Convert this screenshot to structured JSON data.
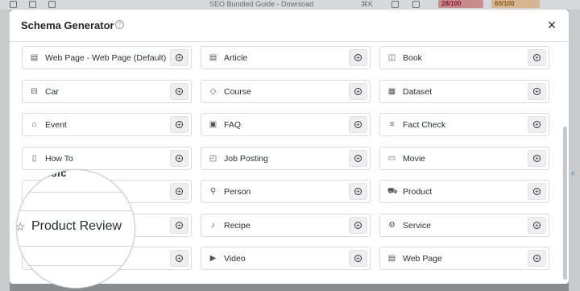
{
  "background": {
    "tab_title": "SEO Bundled Guide - Download",
    "shortcut": "⌘K",
    "score_red": "28/100",
    "score_orange": "60/100"
  },
  "modal": {
    "title": "Schema Generator",
    "help_icon": "question-circle-icon",
    "close_icon": "×"
  },
  "items": [
    {
      "label": "Web Page - Web Page (Default)",
      "icon": "page-icon",
      "glyph": "▤"
    },
    {
      "label": "Article",
      "icon": "article-icon",
      "glyph": "▤"
    },
    {
      "label": "Book",
      "icon": "book-icon",
      "glyph": "◫"
    },
    {
      "label": "Car",
      "icon": "car-icon",
      "glyph": "⊟"
    },
    {
      "label": "Course",
      "icon": "graduation-cap-icon",
      "glyph": "◇"
    },
    {
      "label": "Dataset",
      "icon": "dataset-icon",
      "glyph": "▦"
    },
    {
      "label": "Event",
      "icon": "event-icon",
      "glyph": "⌂"
    },
    {
      "label": "FAQ",
      "icon": "faq-icon",
      "glyph": "▣"
    },
    {
      "label": "Fact Check",
      "icon": "fact-check-icon",
      "glyph": "≡"
    },
    {
      "label": "How To",
      "icon": "how-to-icon",
      "glyph": "▯"
    },
    {
      "label": "Job Posting",
      "icon": "briefcase-icon",
      "glyph": "◰"
    },
    {
      "label": "Movie",
      "icon": "movie-icon",
      "glyph": "▭"
    },
    {
      "label": "",
      "icon": "music-icon",
      "glyph": ""
    },
    {
      "label": "Person",
      "icon": "person-icon",
      "glyph": "⚲"
    },
    {
      "label": "Product",
      "icon": "cart-icon",
      "glyph": "⛟"
    },
    {
      "label": "",
      "icon": "review-icon",
      "glyph": ""
    },
    {
      "label": "Recipe",
      "icon": "recipe-icon",
      "glyph": "♪"
    },
    {
      "label": "Service",
      "icon": "service-icon",
      "glyph": "⚙"
    },
    {
      "label": "",
      "icon": "software-icon",
      "glyph": ""
    },
    {
      "label": "Video",
      "icon": "video-icon",
      "glyph": "▶"
    },
    {
      "label": "Web Page",
      "icon": "web-page-icon",
      "glyph": "▤"
    }
  ],
  "add_glyph": "+",
  "magnifier": {
    "partial_text": "usic",
    "label": "Product Review",
    "icon": "star-icon"
  }
}
